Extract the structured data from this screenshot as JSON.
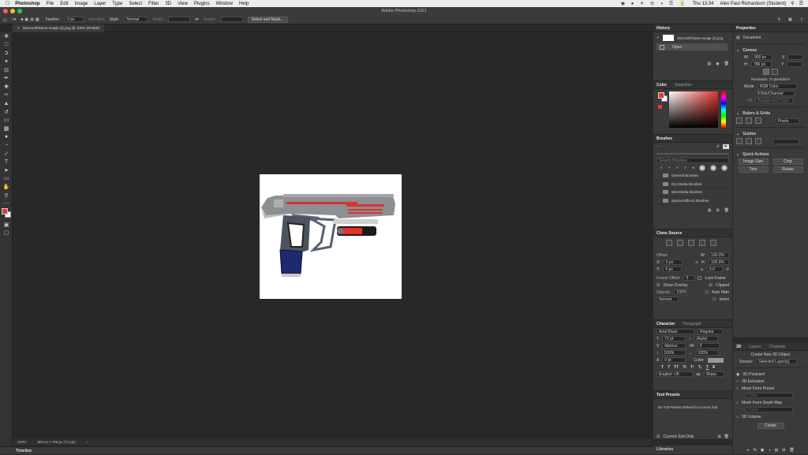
{
  "menubar": {
    "app": "Photoshop",
    "items": [
      "File",
      "Edit",
      "Image",
      "Layer",
      "Type",
      "Select",
      "Filter",
      "3D",
      "View",
      "Plugins",
      "Window",
      "Help"
    ],
    "clock": "Thu 13:34",
    "user": "Alex Paul Richardson (Student)"
  },
  "window_title": "Adobe Photoshop 2021",
  "options_bar": {
    "feather_label": "Feather:",
    "feather_value": "0 px",
    "antialias_label": "Anti-alias",
    "style_label": "Style:",
    "style_value": "Normal",
    "width_label": "Width:",
    "height_label": "Height:",
    "select_mask_btn": "Select and Mask..."
  },
  "document_tab": "MicrosoftTeams-image (2).png @ 100% (RGB/8)",
  "status": {
    "zoom": "100%",
    "dims": "800 px x 786 px (72 ppi)"
  },
  "timeline_label": "Timeline",
  "history": {
    "title": "History",
    "snapshot": "MicrosoftTeams-image (2).png",
    "state": "Open"
  },
  "color_panel": {
    "tabs": [
      "Color",
      "Swatches"
    ],
    "fg": "#e53a2e",
    "bg": "#ffffff"
  },
  "brushes": {
    "title": "Brushes",
    "search_placeholder": "Search Brushes",
    "groups": [
      "General Brushes",
      "Dry Media Brushes",
      "Wet Media Brushes",
      "Special Effects Brushes"
    ]
  },
  "clone_source": {
    "title": "Clone Source",
    "offset_label": "Offset:",
    "x_label": "X:",
    "x": "0 px",
    "y_label": "Y:",
    "y": "0 px",
    "w_label": "W:",
    "w": "100.0%",
    "h_label": "H:",
    "h": "100.0%",
    "angle": "0.0",
    "frame_offset_label": "Frame Offset:",
    "frame_offset": "0",
    "lock_frame": "Lock Frame",
    "show_overlay": "Show Overlay",
    "opacity_label": "Opacity:",
    "opacity": "100%",
    "mode": "Normal",
    "clipped": "Clipped",
    "auto_hide": "Auto Hide",
    "invert": "Invert"
  },
  "character": {
    "tabs": [
      "Character",
      "Paragraph"
    ],
    "font": "Arial Black",
    "style": "Regular",
    "size": "72 pt",
    "leading": "(Auto)",
    "kerning": "Metrics",
    "tracking": "0",
    "vscale": "100%",
    "hscale": "100%",
    "baseline": "0 pt",
    "color_label": "Color:",
    "language": "English: UK",
    "aa": "Sharp"
  },
  "tool_presets": {
    "title": "Tool Presets",
    "empty_msg": "No Tool Presets Defined for Current Tool.",
    "current_only": "Current Tool Only"
  },
  "libraries_label": "Libraries",
  "properties": {
    "title": "Properties",
    "doc_label": "Document",
    "canvas_label": "Canvas",
    "w_label": "W:",
    "w": "800 px",
    "h_label": "H:",
    "h": "786 px",
    "x_label": "X",
    "y_label": "Y",
    "resolution": "Resolution: 72 pixels/inch",
    "mode_label": "Mode",
    "mode": "RGB Color",
    "depth": "8 Bits/Channel",
    "fill_label": "Fill",
    "fill_value": "Background Color",
    "rulers_label": "Rulers & Grids",
    "units": "Pixels",
    "guides_label": "Guides",
    "quick_actions": "Quick Actions",
    "image_size": "Image Size",
    "crop": "Crop",
    "trim": "Trim",
    "rotate": "Rotate"
  },
  "layers_3d": {
    "tabs": [
      "3D",
      "Layers",
      "Channels"
    ],
    "create_title": "Create New 3D Object",
    "source_label": "Source:",
    "source": "Selected Layer(s)",
    "options": [
      "3D Postcard",
      "3D Extrusion",
      "Mesh From Preset",
      "Mesh From Depth Map",
      "3D Volume"
    ],
    "preset": "Cone",
    "depth_map": "Plane",
    "create_btn": "Create"
  }
}
